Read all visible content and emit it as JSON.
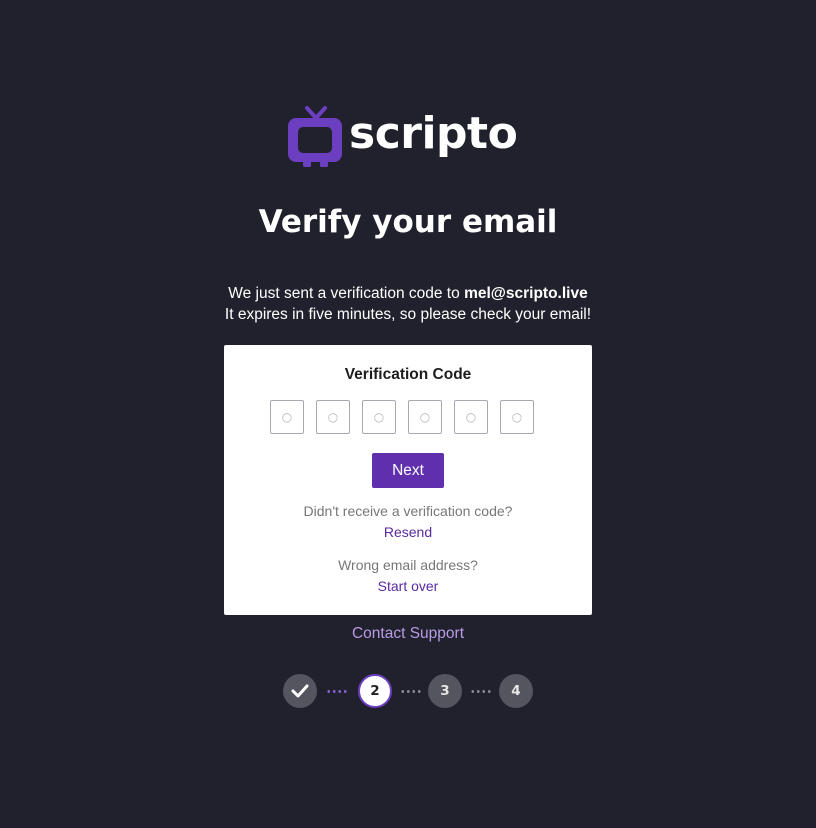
{
  "brand": {
    "name": "scripto",
    "accent_color": "#6b3fc0",
    "icon": "tv-icon"
  },
  "page": {
    "title": "Verify your email",
    "intro_prefix": "We just sent a verification code to",
    "email": "mel@scripto.live",
    "intro_line2": "It expires in five minutes, so please check your email!"
  },
  "card": {
    "label": "Verification Code",
    "code_placeholders": [
      "○",
      "○",
      "○",
      "○",
      "○",
      "○"
    ],
    "next_label": "Next",
    "resend_question": "Didn't receive a verification code?",
    "resend_link": "Resend",
    "wrong_email_question": "Wrong email address?",
    "start_over_link": "Start over"
  },
  "support_link": "Contact Support",
  "steps": {
    "current": 2,
    "items": [
      {
        "state": "done",
        "label": ""
      },
      {
        "state": "current",
        "label": "2"
      },
      {
        "state": "upcoming",
        "label": "3"
      },
      {
        "state": "upcoming",
        "label": "4"
      }
    ]
  }
}
